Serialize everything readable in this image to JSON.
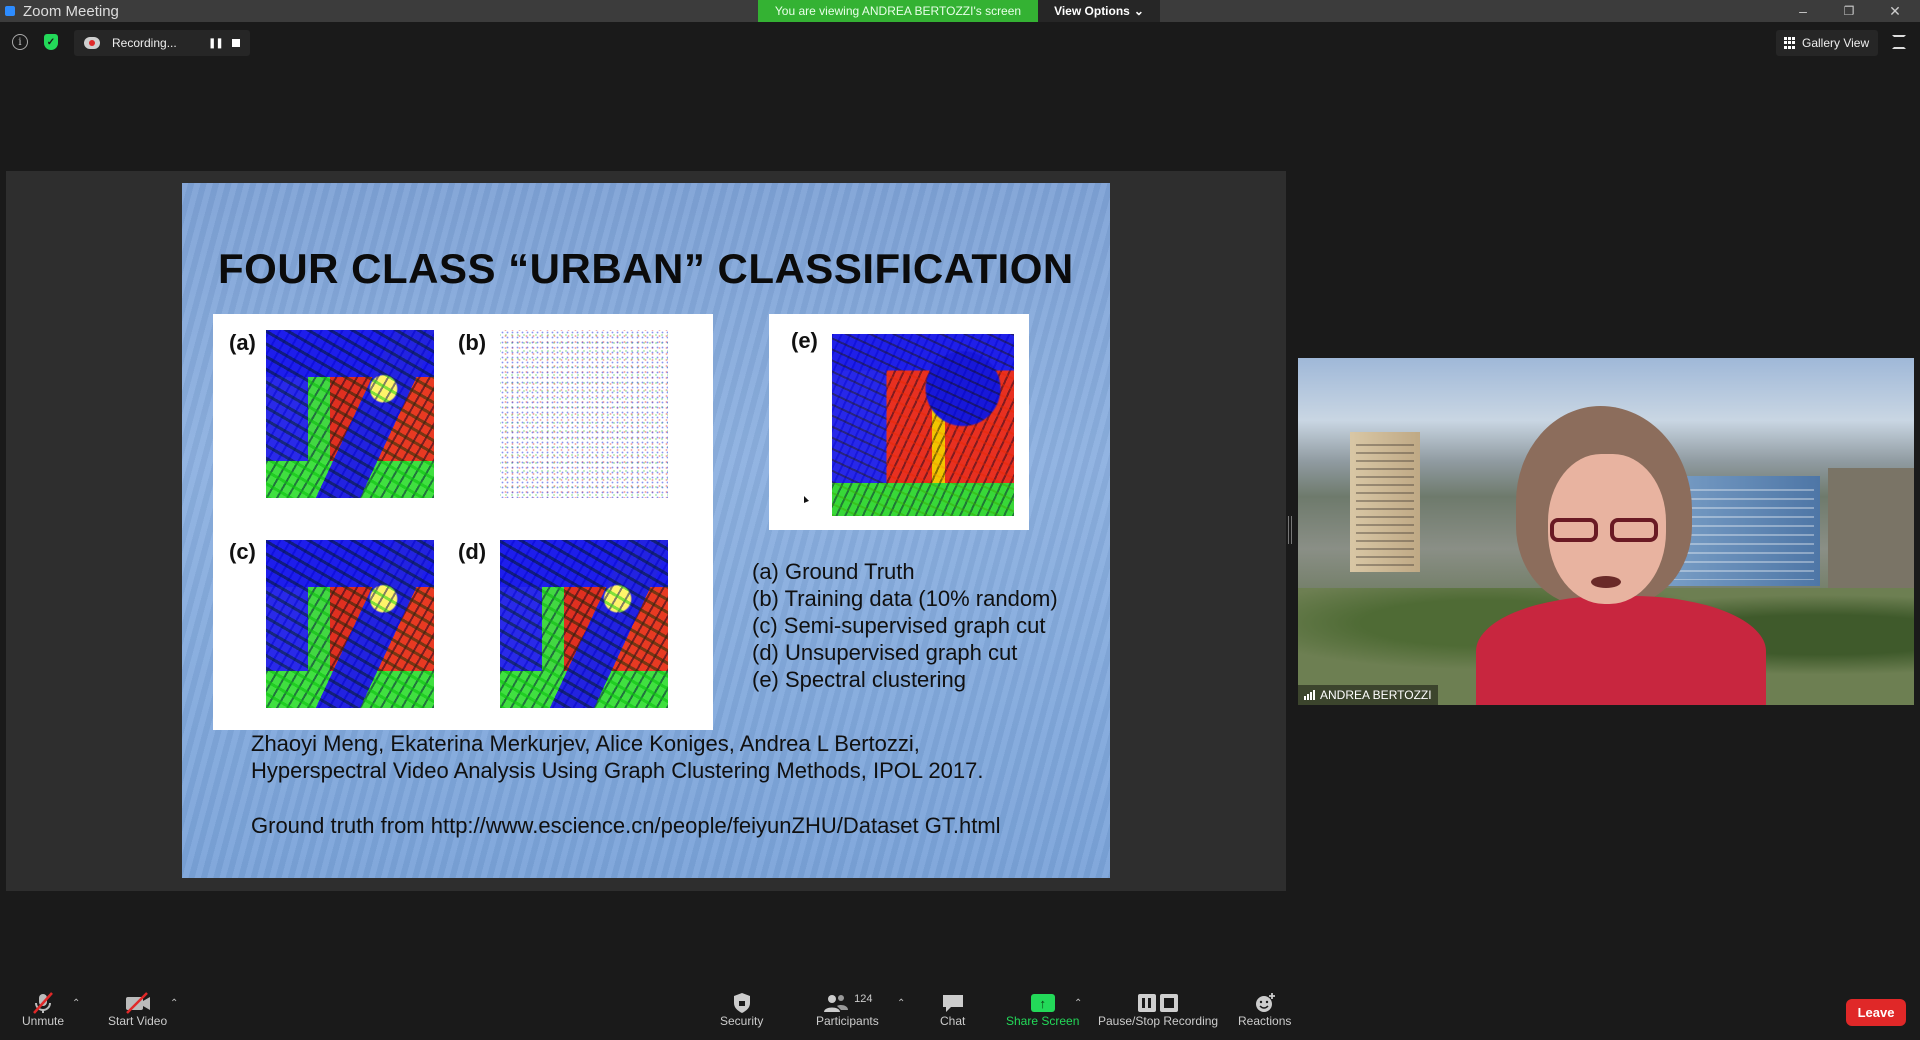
{
  "window": {
    "title": "Zoom Meeting"
  },
  "banner": {
    "viewing_text": "You are viewing ANDREA BERTOZZI's screen",
    "view_options": "View Options"
  },
  "recording": {
    "label": "Recording..."
  },
  "gallery": {
    "label": "Gallery View"
  },
  "slide": {
    "title": "FOUR CLASS “URBAN” CLASSIFICATION",
    "panel_labels": {
      "a": "(a)",
      "b": "(b)",
      "c": "(c)",
      "d": "(d)",
      "e": "(e)"
    },
    "legend": [
      "(a) Ground Truth",
      "(b) Training data (10% random)",
      "(c) Semi-supervised graph cut",
      "(d) Unsupervised graph cut",
      "(e) Spectral clustering"
    ],
    "citation_line1": "Zhaoyi Meng, Ekaterina Merkurjev, Alice Koniges, Andrea L Bertozzi,",
    "citation_line2": "Hyperspectral Video Analysis Using Graph Clustering Methods, IPOL 2017.",
    "ground_truth": "Ground truth from http://www.escience.cn/people/feiyunZHU/Dataset GT.html"
  },
  "participant": {
    "name": "ANDREA BERTOZZI"
  },
  "toolbar": {
    "unmute": "Unmute",
    "start_video": "Start Video",
    "security": "Security",
    "participants": "Participants",
    "participants_count": "124",
    "chat": "Chat",
    "share_screen": "Share Screen",
    "pause_stop_recording": "Pause/Stop Recording",
    "reactions": "Reactions",
    "leave": "Leave"
  },
  "colors": {
    "green": "#34b233",
    "share_green": "#23d959",
    "leave_red": "#e02828"
  }
}
